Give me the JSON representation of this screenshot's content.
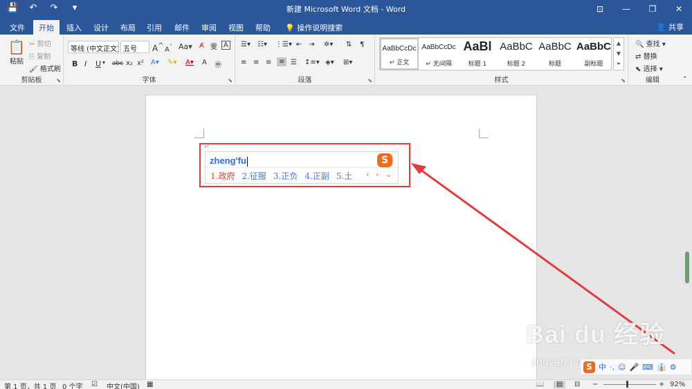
{
  "window": {
    "title": "新建 Microsoft Word 文档 - Word",
    "qat_icons": [
      "save-icon",
      "undo-icon",
      "redo-icon",
      "customize-icon"
    ]
  },
  "tabs": [
    "文件",
    "开始",
    "插入",
    "设计",
    "布局",
    "引用",
    "邮件",
    "审阅",
    "视图",
    "帮助",
    "操作说明搜索"
  ],
  "share_label": "共享",
  "clipboard": {
    "paste": "粘贴",
    "cut": "剪切",
    "copy": "复制",
    "format_painter": "格式刷",
    "label": "剪贴板"
  },
  "font": {
    "name": "等线 (中文正文)",
    "size": "五号",
    "grow": "A",
    "shrink": "A",
    "case": "Aa",
    "bold": "B",
    "italic": "I",
    "underline": "U",
    "strike": "abc",
    "subscript": "x₂",
    "superscript": "x²",
    "label": "字体"
  },
  "paragraph": {
    "label": "段落"
  },
  "styles": {
    "items": [
      {
        "sample": "AaBbCcDc",
        "name": "↵ 正文"
      },
      {
        "sample": "AaBbCcDc",
        "name": "↵ 无间隔"
      },
      {
        "sample": "AaBl",
        "name": "标题 1"
      },
      {
        "sample": "AaBbC",
        "name": "标题 2"
      },
      {
        "sample": "AaBbC",
        "name": "标题"
      },
      {
        "sample": "AaBbC",
        "name": "副标题"
      }
    ],
    "label": "样式"
  },
  "editing": {
    "find": "查找",
    "replace": "替换",
    "select": "选择",
    "label": "编辑"
  },
  "ime": {
    "pinyin": "zheng'fu",
    "candidates": [
      "1.政府",
      "2.征服",
      "3.正负",
      "4.正副",
      "5.土"
    ],
    "logo": "S",
    "nav": "‹ › ⌄"
  },
  "status": {
    "page": "第 1 页，共 1 页",
    "words": "0 个字",
    "language": "中文(中国)",
    "zoom": "92%"
  },
  "imebar": {
    "logo": "S",
    "items": [
      "中",
      "·,",
      "☺",
      "🎤",
      "⌨",
      "👔",
      "⚙"
    ]
  },
  "watermark": {
    "main": "Bai du 经验",
    "sub": "jingyan.baidu.com"
  },
  "colors": {
    "brand": "#2b579a",
    "highlight": "#e03c3c",
    "ime_orange": "#f26b1d"
  }
}
